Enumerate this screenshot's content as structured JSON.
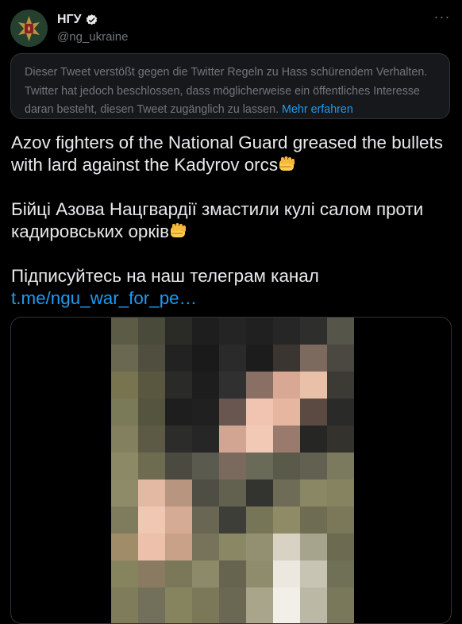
{
  "author": {
    "name": "НГУ",
    "handle": "@ng_ukraine",
    "avatar_icon": "ngu-emblem-icon",
    "verified_icon": "verified-badge-icon"
  },
  "menu": {
    "icon": "more-options-icon",
    "label": "···"
  },
  "notice": {
    "text": "Dieser Tweet verstößt gegen die Twitter Regeln zu Hass schürendem Verhalten. Twitter hat jedoch beschlossen, dass möglicherweise ein öffentliches Interesse daran besteht, diesen Tweet zugänglich zu lassen.",
    "link": "Mehr erfahren"
  },
  "tweet": {
    "line_en": "Azov fighters of the National Guard greased the bullets with lard against the Kadyrov orcs",
    "line_uk": "Бійці Азова Нацгвардії змастили кулі салом проти кадировських орків",
    "line_sub": "Підписуйтесь на наш телеграм канал",
    "link": "t.me/ngu_war_for_pe…",
    "emoji_icon": "oncoming-fist-icon"
  },
  "media": {
    "description_icon": "pixelated-video-thumbnail"
  },
  "colors": {
    "background": "#000000",
    "text": "#e7e9ea",
    "muted": "#71767b",
    "link": "#1d9bf0",
    "border": "#2f3336",
    "notice_bg": "#16181c"
  }
}
